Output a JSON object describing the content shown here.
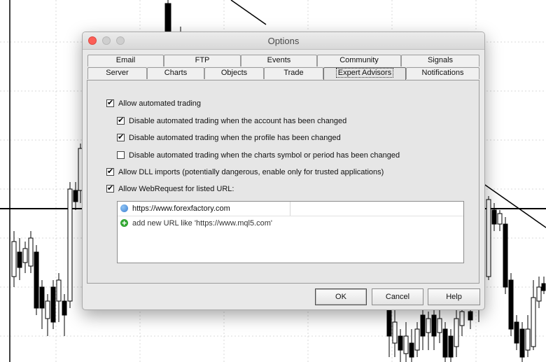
{
  "window": {
    "title": "Options"
  },
  "tabs_row1": [
    {
      "label": "Email"
    },
    {
      "label": "FTP"
    },
    {
      "label": "Events"
    },
    {
      "label": "Community"
    },
    {
      "label": "Signals"
    }
  ],
  "tabs_row2": [
    {
      "label": "Server"
    },
    {
      "label": "Charts"
    },
    {
      "label": "Objects"
    },
    {
      "label": "Trade"
    },
    {
      "label": "Expert Advisors",
      "active": true
    },
    {
      "label": "Notifications"
    }
  ],
  "options": {
    "allow_automated": {
      "label": "Allow automated trading",
      "checked": true
    },
    "disable_account": {
      "label": "Disable automated trading when the account has been changed",
      "checked": true
    },
    "disable_profile": {
      "label": "Disable automated trading when the profile has been changed",
      "checked": true
    },
    "disable_symbol": {
      "label": "Disable automated trading when the charts symbol or period has been changed",
      "checked": false
    },
    "allow_dll": {
      "label": "Allow DLL imports (potentially dangerous, enable only for trusted applications)",
      "checked": true
    },
    "allow_webrequest": {
      "label": "Allow WebRequest for listed URL:",
      "checked": true
    }
  },
  "url_list": {
    "urls": [
      "https://www.forexfactory.com"
    ],
    "add_hint": "add new URL like 'https://www.mql5.com'"
  },
  "buttons": {
    "ok": "OK",
    "cancel": "Cancel",
    "help": "Help"
  },
  "colors": {
    "close_button": "#fc5f57",
    "globe_icon": "#3b7fd0",
    "add_icon": "#2fa52f"
  }
}
